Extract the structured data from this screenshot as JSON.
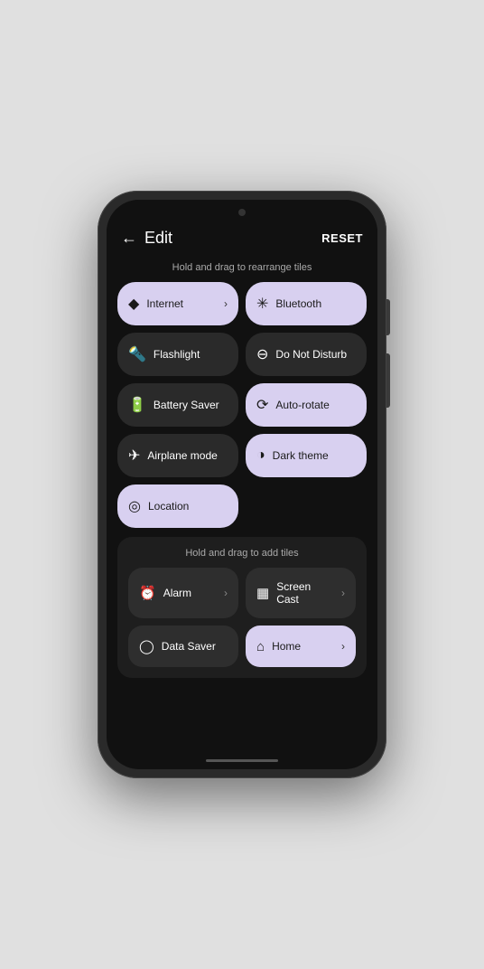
{
  "header": {
    "back_label": "←",
    "title": "Edit",
    "reset_label": "RESET"
  },
  "hint": {
    "arrange": "Hold and drag to rearrange tiles",
    "add": "Hold and drag to add tiles"
  },
  "tiles": [
    {
      "id": "internet",
      "label": "Internet",
      "icon": "◆",
      "style": "light",
      "has_arrow": true
    },
    {
      "id": "bluetooth",
      "label": "Bluetooth",
      "icon": "*",
      "style": "light",
      "has_arrow": false
    },
    {
      "id": "flashlight",
      "label": "Flashlight",
      "icon": "▣",
      "style": "dark",
      "has_arrow": false
    },
    {
      "id": "do-not-disturb",
      "label": "Do Not Disturb",
      "icon": "⊖",
      "style": "dark",
      "has_arrow": false
    },
    {
      "id": "battery-saver",
      "label": "Battery Saver",
      "icon": "⊟",
      "style": "dark",
      "has_arrow": false
    },
    {
      "id": "auto-rotate",
      "label": "Auto-rotate",
      "icon": "⟳",
      "style": "light",
      "has_arrow": false
    },
    {
      "id": "airplane-mode",
      "label": "Airplane mode",
      "icon": "✈",
      "style": "dark",
      "has_arrow": false
    },
    {
      "id": "dark-theme",
      "label": "Dark theme",
      "icon": "◑",
      "style": "light",
      "has_arrow": false
    },
    {
      "id": "location",
      "label": "Location",
      "icon": "◎",
      "style": "light",
      "has_arrow": false,
      "full": true
    }
  ],
  "add_tiles": [
    {
      "id": "alarm",
      "label": "Alarm",
      "icon": "◷",
      "style": "dark",
      "has_arrow": true
    },
    {
      "id": "screen-cast",
      "label": "Screen Cast",
      "icon": "▦",
      "style": "dark",
      "has_arrow": true
    },
    {
      "id": "data-saver",
      "label": "Data Saver",
      "icon": "◯",
      "style": "dark",
      "has_arrow": false
    },
    {
      "id": "home",
      "label": "Home",
      "icon": "⌂",
      "style": "light",
      "has_arrow": true
    }
  ]
}
